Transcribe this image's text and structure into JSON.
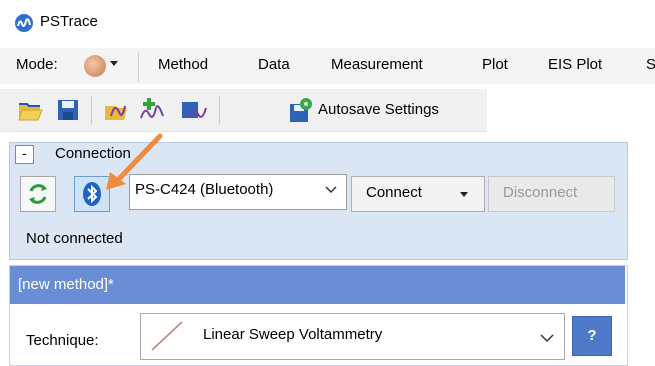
{
  "window": {
    "title": "PSTrace"
  },
  "menu": {
    "mode_label": "Mode:",
    "items": [
      "Method",
      "Data",
      "Measurement",
      "Plot",
      "EIS Plot",
      "S"
    ]
  },
  "toolbar": {
    "autosave_label": "Autosave Settings"
  },
  "connection": {
    "collapse_symbol": "-",
    "title": "Connection",
    "device": "PS-C424 (Bluetooth)",
    "connect_label": "Connect",
    "disconnect_label": "Disconnect",
    "status": "Not connected"
  },
  "method": {
    "title": "[new method]*",
    "technique_label": "Technique:",
    "technique_value": "Linear Sweep Voltammetry",
    "help_label": "?"
  },
  "colors": {
    "connection_bg": "#dbe6f4",
    "method_header": "#6a8ed6",
    "help_button": "#4e79c9",
    "annotation_arrow": "#f08a3c"
  },
  "icons": [
    "pstrace-logo-icon",
    "mode-icon",
    "open-folder-icon",
    "save-icon",
    "open-measurement-icon",
    "add-measurement-icon",
    "save-measurement-icon",
    "autosave-settings-icon",
    "refresh-icon",
    "bluetooth-icon",
    "dropdown-caret-icon",
    "linear-sweep-icon"
  ]
}
